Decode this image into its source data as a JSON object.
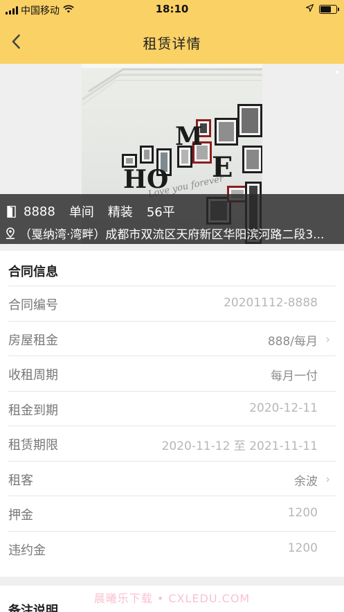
{
  "status_bar": {
    "carrier": "中国移动",
    "time": "18:10",
    "battery_level": 0.7
  },
  "navbar": {
    "title": "租赁详情",
    "back_icon": "chevron-left-icon"
  },
  "hero": {
    "room_number": "8888",
    "room_type": "单间",
    "decoration": "精装",
    "area": "56平",
    "address": "（戛纳湾·湾畔）成都市双流区天府新区华阳滨河路二段3...",
    "photo_letters": [
      "M",
      "HO",
      "E"
    ],
    "photo_tagline": "Love you forever"
  },
  "contract": {
    "title": "合同信息",
    "rows": [
      {
        "label": "合同编号",
        "value": "20201112-8888",
        "chevron": false
      },
      {
        "label": "房屋租金",
        "value": "888/每月",
        "chevron": true
      },
      {
        "label": "收租周期",
        "value": "每月一付",
        "chevron": false
      },
      {
        "label": "租金到期",
        "value": "2020-12-11",
        "chevron": false
      },
      {
        "label": "租赁期限",
        "value": "2020-11-12 至 2021-11-11",
        "chevron": false
      },
      {
        "label": "租客",
        "value": "余波",
        "chevron": true
      },
      {
        "label": "押金",
        "value": "1200",
        "chevron": false
      },
      {
        "label": "违约金",
        "value": "1200",
        "chevron": false
      }
    ]
  },
  "remarks": {
    "title": "备注说明"
  },
  "watermark": "晨曦乐下载 • CXLEDU.COM",
  "colors": {
    "header_bg": "#fad165",
    "page_bg": "#efefef"
  }
}
